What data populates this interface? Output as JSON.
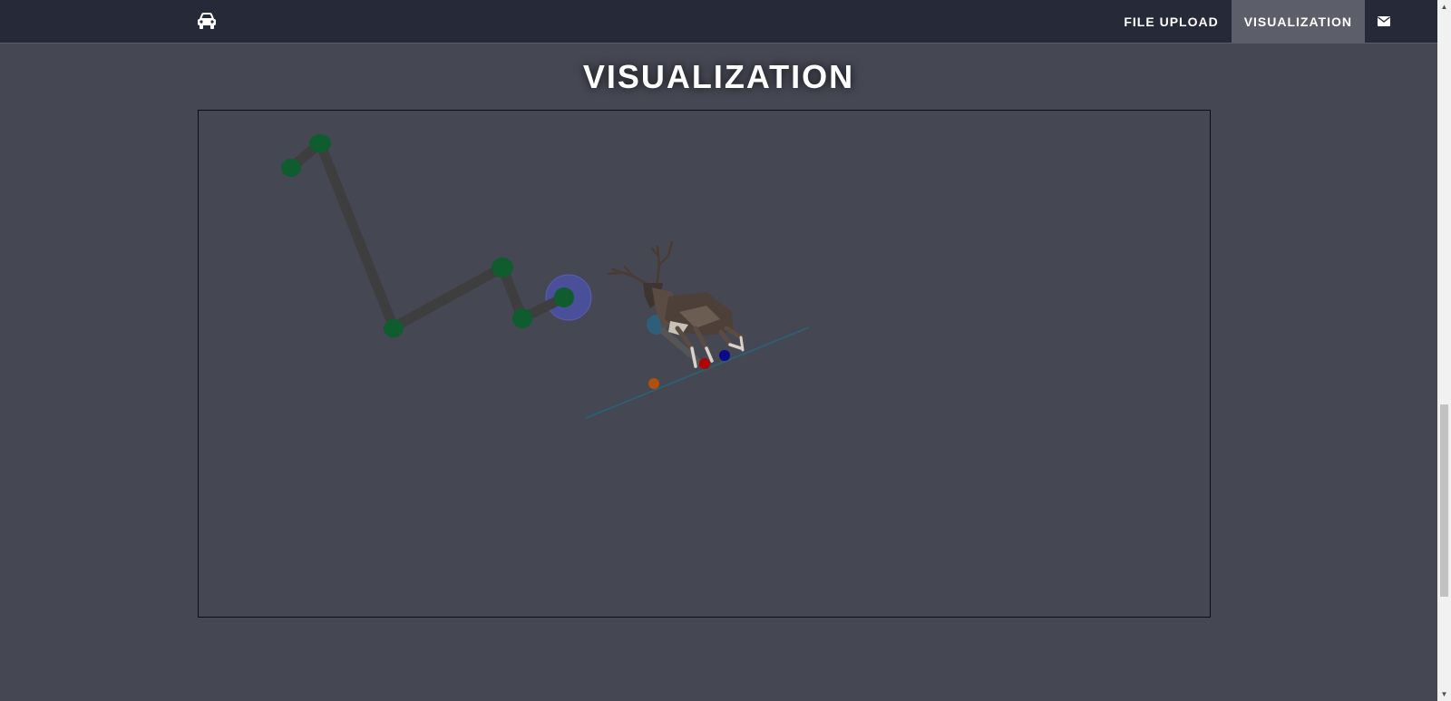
{
  "navbar": {
    "brand_icon": "car-icon",
    "links": [
      {
        "label": "FILE UPLOAD",
        "active": false
      },
      {
        "label": "VISUALIZATION",
        "active": true
      }
    ],
    "mail_icon": "envelope-icon"
  },
  "page": {
    "title": "VISUALIZATION"
  },
  "visualization": {
    "model": "deer-model",
    "colors": {
      "joint": "#0f5c2e",
      "bone": "#3e3e3e",
      "target": "#4a4f9a",
      "ground_line": "#2e5e72",
      "marker_red": "#b00000",
      "marker_blue": "#0a0a8a",
      "marker_orange": "#b0500a",
      "marker_teal": "#2e5e7a"
    }
  }
}
